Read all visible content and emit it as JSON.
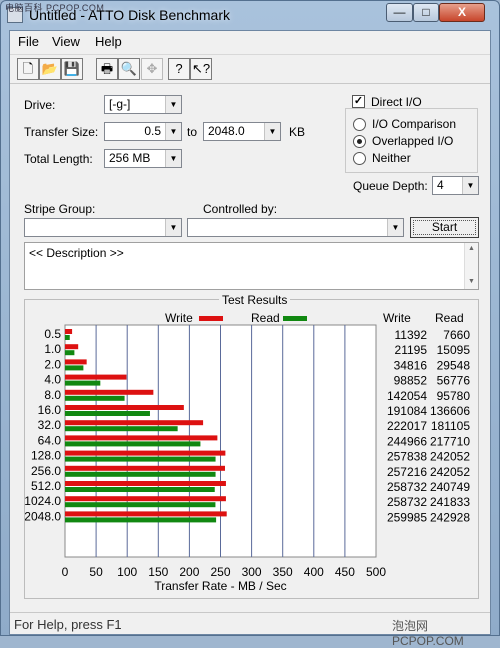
{
  "window": {
    "title": "Untitled - ATTO Disk Benchmark",
    "watermark_top": "电脑百科 PCPOP.COM",
    "watermark_bottom": "泡泡网 PCPOP.COM",
    "minimize_glyph": "—",
    "maximize_glyph": "□",
    "close_glyph": "X"
  },
  "menu": {
    "file": "File",
    "view": "View",
    "help": "Help"
  },
  "toolbar": {
    "new_icon": "new-document-icon",
    "open_icon": "open-folder-icon",
    "save_icon": "save-disk-icon",
    "print_icon": "printer-icon",
    "preview_icon": "print-preview-icon",
    "move_icon": "move-cross-icon",
    "help_icon": "help-question-icon",
    "whatsthis_icon": "context-help-icon",
    "new_glyph": "🗋",
    "open_glyph": "📂",
    "save_glyph": "💾",
    "print_glyph": "🖶",
    "preview_glyph": "🔍",
    "move_glyph": "✥",
    "help_glyph": "?",
    "whatsthis_glyph": "↖?"
  },
  "settings": {
    "drive_label": "Drive:",
    "drive_value": "[-g-]",
    "transfer_size_label": "Transfer Size:",
    "transfer_from": "0.5",
    "to_label": "to",
    "transfer_to": "2048.0",
    "unit_kb": "KB",
    "total_length_label": "Total Length:",
    "total_length_value": "256 MB",
    "direct_io_label": "Direct I/O",
    "direct_io_checked": true,
    "io_options": [
      "I/O Comparison",
      "Overlapped I/O",
      "Neither"
    ],
    "io_selected": "Overlapped I/O",
    "queue_depth_label": "Queue Depth:",
    "queue_depth_value": "4",
    "stripe_group_label": "Stripe Group:",
    "stripe_group_value": "",
    "controlled_by_label": "Controlled by:",
    "controlled_by_value": "",
    "start_label": "Start",
    "description_text": "<< Description >>"
  },
  "results": {
    "title": "Test Results",
    "write_label": "Write",
    "read_label": "Read",
    "write_header": "Write",
    "read_header": "Read",
    "x_axis_label": "Transfer Rate - MB / Sec"
  },
  "chart_data": {
    "type": "bar",
    "orientation": "horizontal",
    "categories": [
      "0.5",
      "1.0",
      "2.0",
      "4.0",
      "8.0",
      "16.0",
      "32.0",
      "64.0",
      "128.0",
      "256.0",
      "512.0",
      "1024.0",
      "2048.0"
    ],
    "series": [
      {
        "name": "Write",
        "color": "#dd1111",
        "values": [
          11392,
          21195,
          34816,
          98852,
          142054,
          191084,
          222017,
          244966,
          257838,
          257216,
          258732,
          258732,
          259985
        ]
      },
      {
        "name": "Read",
        "color": "#118811",
        "values": [
          7660,
          15095,
          29548,
          56776,
          95780,
          136606,
          181105,
          217710,
          242052,
          242052,
          240749,
          241833,
          242928
        ]
      }
    ],
    "values_unit_note": "table values in KB/s",
    "xlim": [
      0,
      500
    ],
    "x_ticks": [
      "0",
      "50",
      "100",
      "150",
      "200",
      "250",
      "300",
      "350",
      "400",
      "450",
      "500"
    ],
    "xlabel": "Transfer Rate - MB / Sec",
    "grid": true,
    "legend": "top"
  },
  "status": {
    "text": "For Help, press F1"
  }
}
